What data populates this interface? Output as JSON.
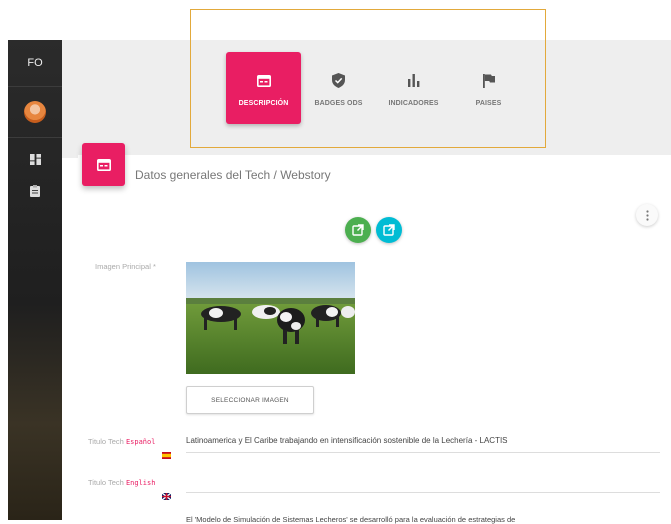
{
  "sidebar": {
    "initials": "FO",
    "items": [
      {
        "icon": "dashboard-icon"
      },
      {
        "icon": "clipboard-icon"
      }
    ]
  },
  "tabs": [
    {
      "label": "DESCRIPCIÓN",
      "icon": "web-window-icon",
      "active": true
    },
    {
      "label": "BADGES ODS",
      "icon": "shield-check-icon",
      "active": false
    },
    {
      "label": "INDICADORES",
      "icon": "bar-chart-icon",
      "active": false
    },
    {
      "label": "PAISES",
      "icon": "flag-icon",
      "active": false
    }
  ],
  "card": {
    "title": "Datos generales del Tech / Webstory",
    "icon": "web-window-icon"
  },
  "form": {
    "image_label": "Imagen Principal *",
    "select_image_label": "SELECCIONAR IMAGEN",
    "title_es_prefix": "Titulo Tech",
    "title_es_lang": "Español",
    "title_es_value": "Latinoamerica y El Caribe trabajando en intensificación sostenible de la Lechería - LACTIS",
    "title_en_prefix": "Titulo Tech",
    "title_en_lang": "English",
    "title_en_value": "",
    "description_value": "El 'Modelo de Simulación de Sistemas Lecheros' se desarrolló para la evaluación de estrategias de"
  },
  "colors": {
    "accent": "#e91e63",
    "green": "#4caf50",
    "cyan": "#00bcd4",
    "highlight": "#e2a93b"
  }
}
